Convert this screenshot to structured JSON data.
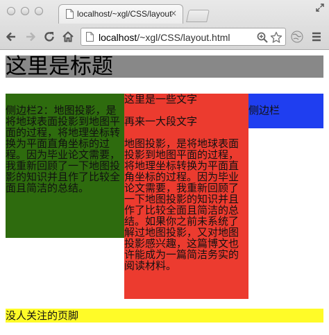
{
  "browser": {
    "tab_title": "localhost/~xgl/CSS/layout",
    "tab_close": "×",
    "url_host": "localhost",
    "url_path": "/~xgl/CSS/layout.html"
  },
  "page": {
    "header_title": "这里是标题",
    "sidebar2_text": "侧边栏2：地图投影，是将地球表面投影到地图平面的过程，将地理坐标转换为平面直角坐标的过程。因为毕业论文需要，我重新回顾了一下地图投影的知识并且作了比较全面且简洁的总结。",
    "content_para1": "这里是一些文字",
    "content_para2": "再来一大段文字",
    "content_para3": "地图投影，是将地球表面投影到地图平面的过程，将地理坐标转换为平面直角坐标的过程。因为毕业论文需要，我重新回顾了一下地图投影的知识并且作了比较全面且简洁的总结。如果你之前未系统了解过地图投影，又对地图投影感兴趣，这篇博文也许能成为一篇简洁务实的阅读材料。",
    "sidebar1_text": "侧边栏",
    "footer_text": "没人关注的页脚"
  },
  "colors": {
    "header_bg": "#888888",
    "sidebar2_bg": "#2e6b0e",
    "content_bg": "#ec3b2f",
    "sidebar1_bg": "#1f3ef0",
    "footer_bg": "#fffb28"
  },
  "icons": {
    "close_window": "close-window-icon",
    "minimize_window": "minimize-window-icon",
    "zoom_window": "zoom-window-icon",
    "back": "back-arrow-icon",
    "forward": "forward-arrow-icon",
    "reload": "reload-icon",
    "home": "home-icon",
    "page": "page-icon",
    "zoom": "magnifier-icon",
    "bookmark": "star-icon",
    "extension": "globe-icon",
    "menu": "menu-icon"
  }
}
